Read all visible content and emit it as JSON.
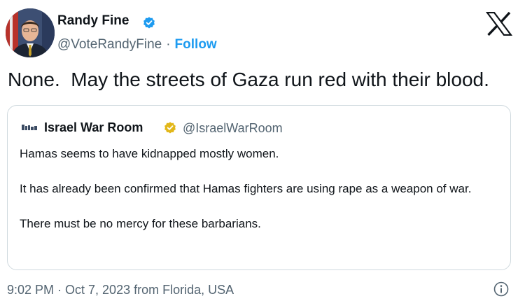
{
  "author": {
    "display_name": "Randy Fine",
    "handle": "@VoteRandyFine",
    "separator": "·",
    "follow_label": "Follow",
    "verified_color": "#1d9bf0"
  },
  "tweet": {
    "text": "None.  May the streets of Gaza run red with their blood."
  },
  "quote": {
    "display_name": "Israel War Room",
    "handle": "@IsraelWarRoom",
    "verified_color": "#e2b719",
    "paragraphs": [
      "Hamas seems to have kidnapped mostly women.",
      "It has already been confirmed that Hamas fighters are using rape as a weapon of war.",
      "There must be no mercy for these barbarians."
    ]
  },
  "footer": {
    "timestamp": "9:02 PM · Oct 7, 2023 from Florida, USA"
  },
  "icons": {
    "platform": "x-logo-icon",
    "verified": "verified-badge-icon",
    "info": "info-icon"
  },
  "colors": {
    "text": "#0f1419",
    "secondary": "#536471",
    "link": "#1d9bf0",
    "border": "#cfd9de"
  }
}
